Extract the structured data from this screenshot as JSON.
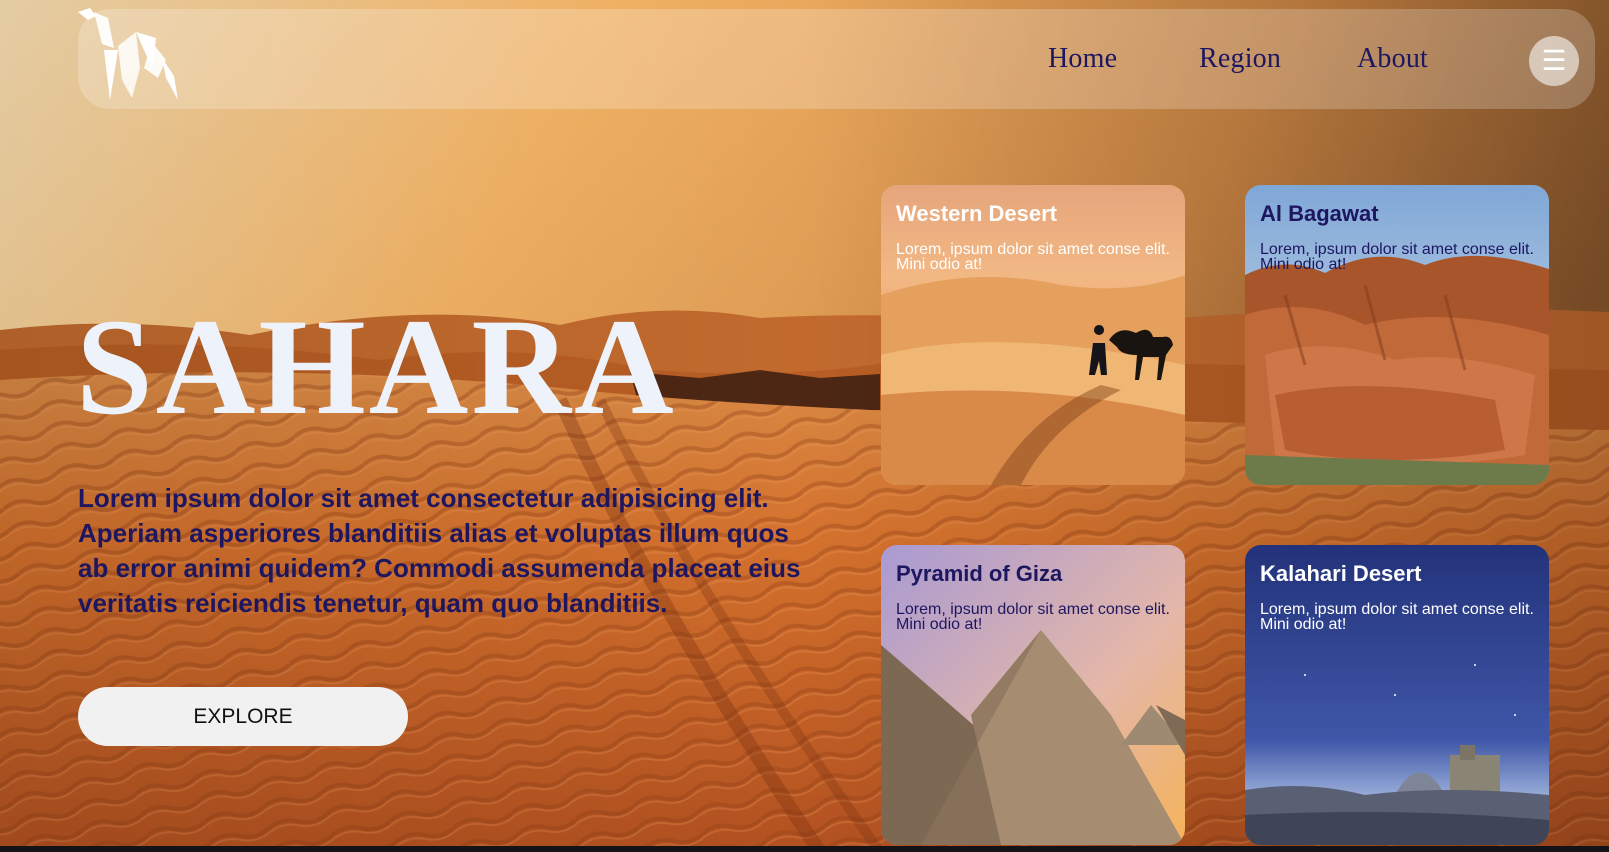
{
  "nav": {
    "logo_icon": "origami-camel-icon",
    "links": [
      "Home",
      "Region",
      "About"
    ],
    "menu_icon": "hamburger-menu-icon",
    "menu_glyph": "☰"
  },
  "hero": {
    "title": "SAHARA",
    "text": "Lorem ipsum dolor sit amet consectetur adipisicing elit. Aperiam asperiores blanditiis alias et voluptas illum quos ab error animi quidem? Commodi assumenda placeat eius veritatis reiciendis tenetur, quam quo blanditiis.",
    "explore_label": "EXPLORE"
  },
  "cards": [
    {
      "title": "Western Desert",
      "text": "Lorem, ipsum dolor sit amet conse elit. Mini odio at!",
      "image": "camel-walker-dunes"
    },
    {
      "title": "Al Bagawat",
      "text": "Lorem, ipsum dolor sit amet conse elit. Mini odio at!",
      "image": "red-rock-canyon"
    },
    {
      "title": "Pyramid of Giza",
      "text": "Lorem, ipsum dolor sit amet conse elit. Mini odio at!",
      "image": "pyramids-sunset"
    },
    {
      "title": "Kalahari Desert",
      "text": "Lorem, ipsum dolor sit amet conse elit. Mini odio at!",
      "image": "night-ruins"
    }
  ],
  "colors": {
    "brand_text": "#1d1660",
    "title_white": "#eef3fb",
    "sand": "#d9782e",
    "sky": "#f6c27a"
  }
}
